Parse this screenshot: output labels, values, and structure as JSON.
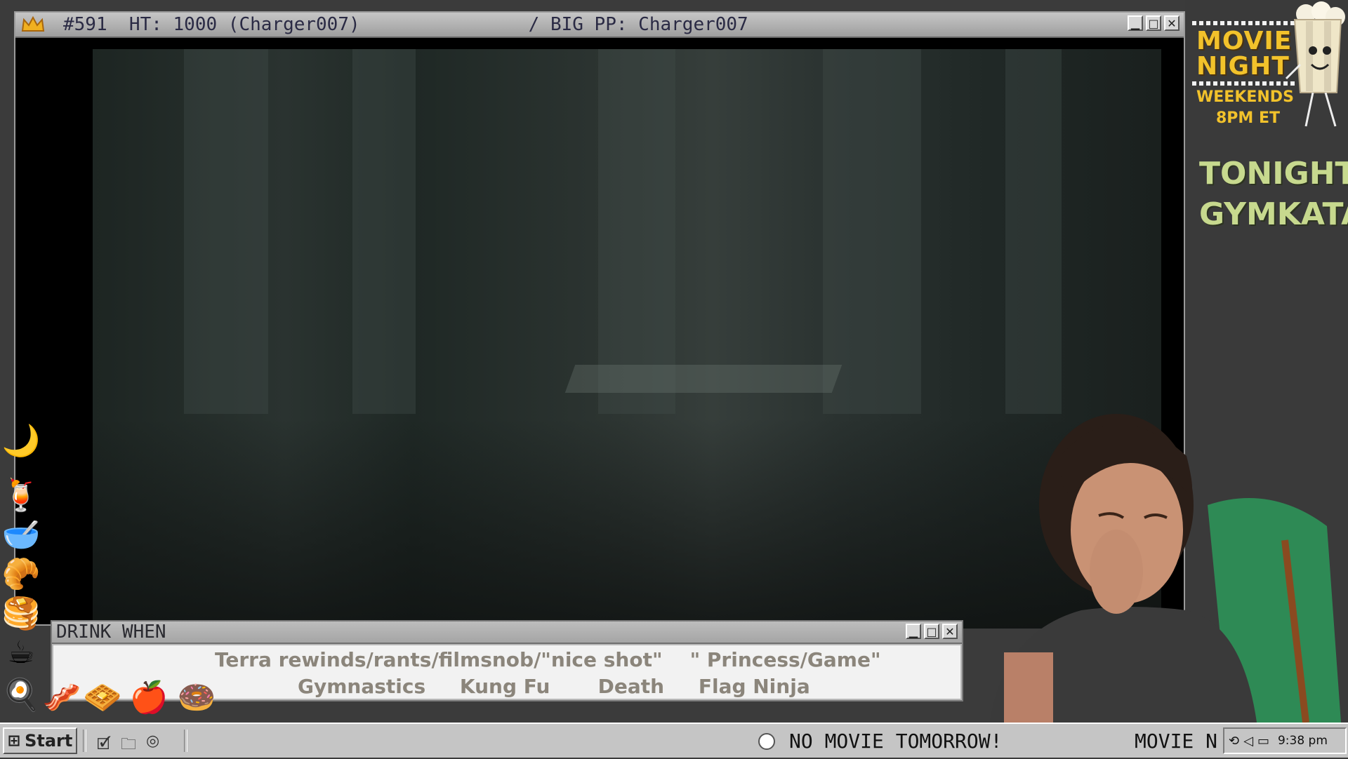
{
  "video_window": {
    "title_left": "#591  HT: 1000 (Charger007)",
    "title_right": "/ BIG PP: Charger007",
    "icons": [
      "crown-icon",
      "minimize-icon",
      "maximize-icon",
      "close-icon"
    ]
  },
  "promo": {
    "line1": "MOVIE",
    "line2": "NIGHT",
    "line3": "WEEKENDS",
    "line4": "8PM ET",
    "tonight_label": "TONIGHT:",
    "tonight_title": "GYMKATA"
  },
  "drink_window": {
    "title": "DRINK WHEN",
    "row1": "Terra rewinds/rants/filmsnob/\"nice shot\"    \" Princess/Game\"",
    "row2": "Gymnastics     Kung Fu       Death     Flag Ninja"
  },
  "taskbar": {
    "start_label": "Start",
    "ticker_main": "NO MOVIE TOMORROW!",
    "ticker_next": "MOVIE N",
    "clock": "9:38 pm"
  },
  "emoji_icons": [
    "moon-icon",
    "orange-juice-icon",
    "cereal-bowl-icon",
    "croissant-icon",
    "pancakes-icon",
    "coffee-mug-icon",
    "fried-egg-icon",
    "bacon-icon",
    "waffle-icon",
    "apple-icon",
    "donut-icon"
  ],
  "colors": {
    "promo_yellow": "#f2c22b",
    "tonight_green": "#c7d98e",
    "titlebar_text": "#2a2a44",
    "taskbar": "#c5c5c5"
  }
}
